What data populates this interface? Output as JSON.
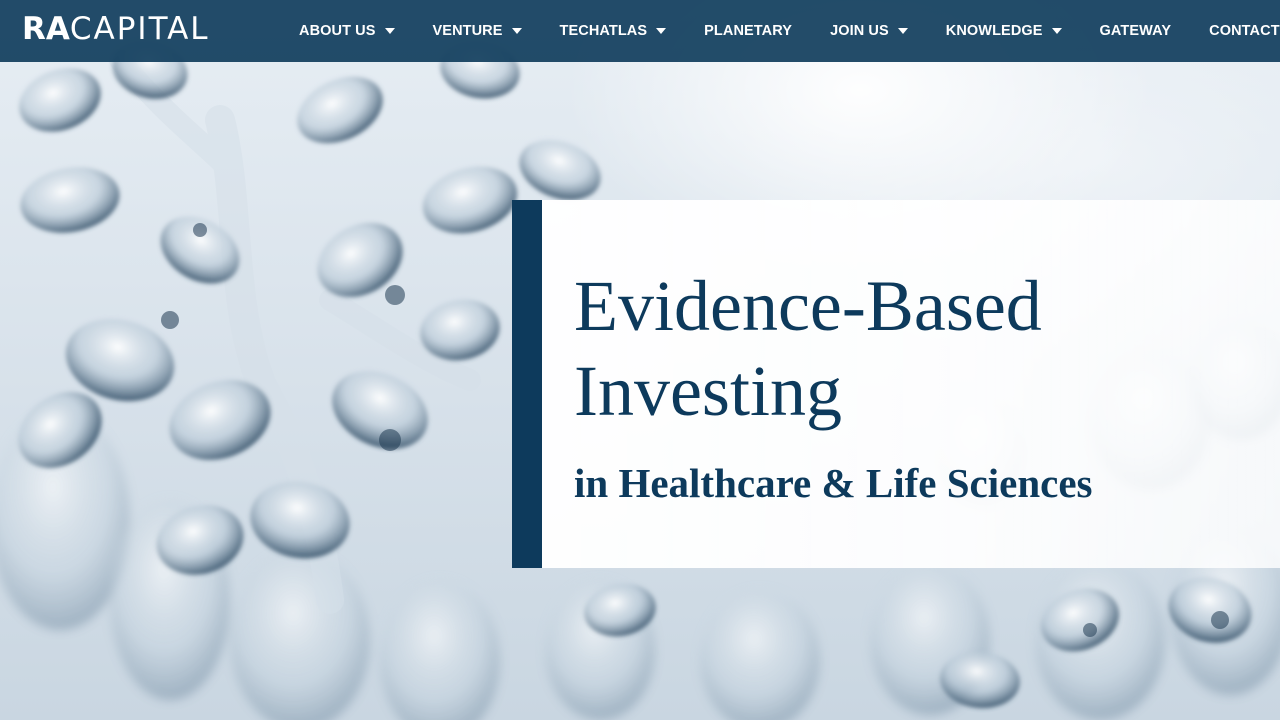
{
  "logo": {
    "part1": "RA",
    "part2": "CAPITAL"
  },
  "nav": [
    {
      "label": "ABOUT US",
      "has_dropdown": true
    },
    {
      "label": "VENTURE",
      "has_dropdown": true
    },
    {
      "label": "TECHATLAS",
      "has_dropdown": true
    },
    {
      "label": "PLANETARY",
      "has_dropdown": false
    },
    {
      "label": "JOIN US",
      "has_dropdown": true
    },
    {
      "label": "KNOWLEDGE",
      "has_dropdown": true
    },
    {
      "label": "GATEWAY",
      "has_dropdown": false
    },
    {
      "label": "CONTACT",
      "has_dropdown": true
    }
  ],
  "hero": {
    "title": "Evidence-Based Investing",
    "subtitle": "in Healthcare & Life Sciences"
  },
  "colors": {
    "header_bg": "#123e5e",
    "brand_navy": "#0d3a5c",
    "nav_text": "#ffffff"
  },
  "icons": {
    "dropdown": "chevron-down-icon"
  }
}
